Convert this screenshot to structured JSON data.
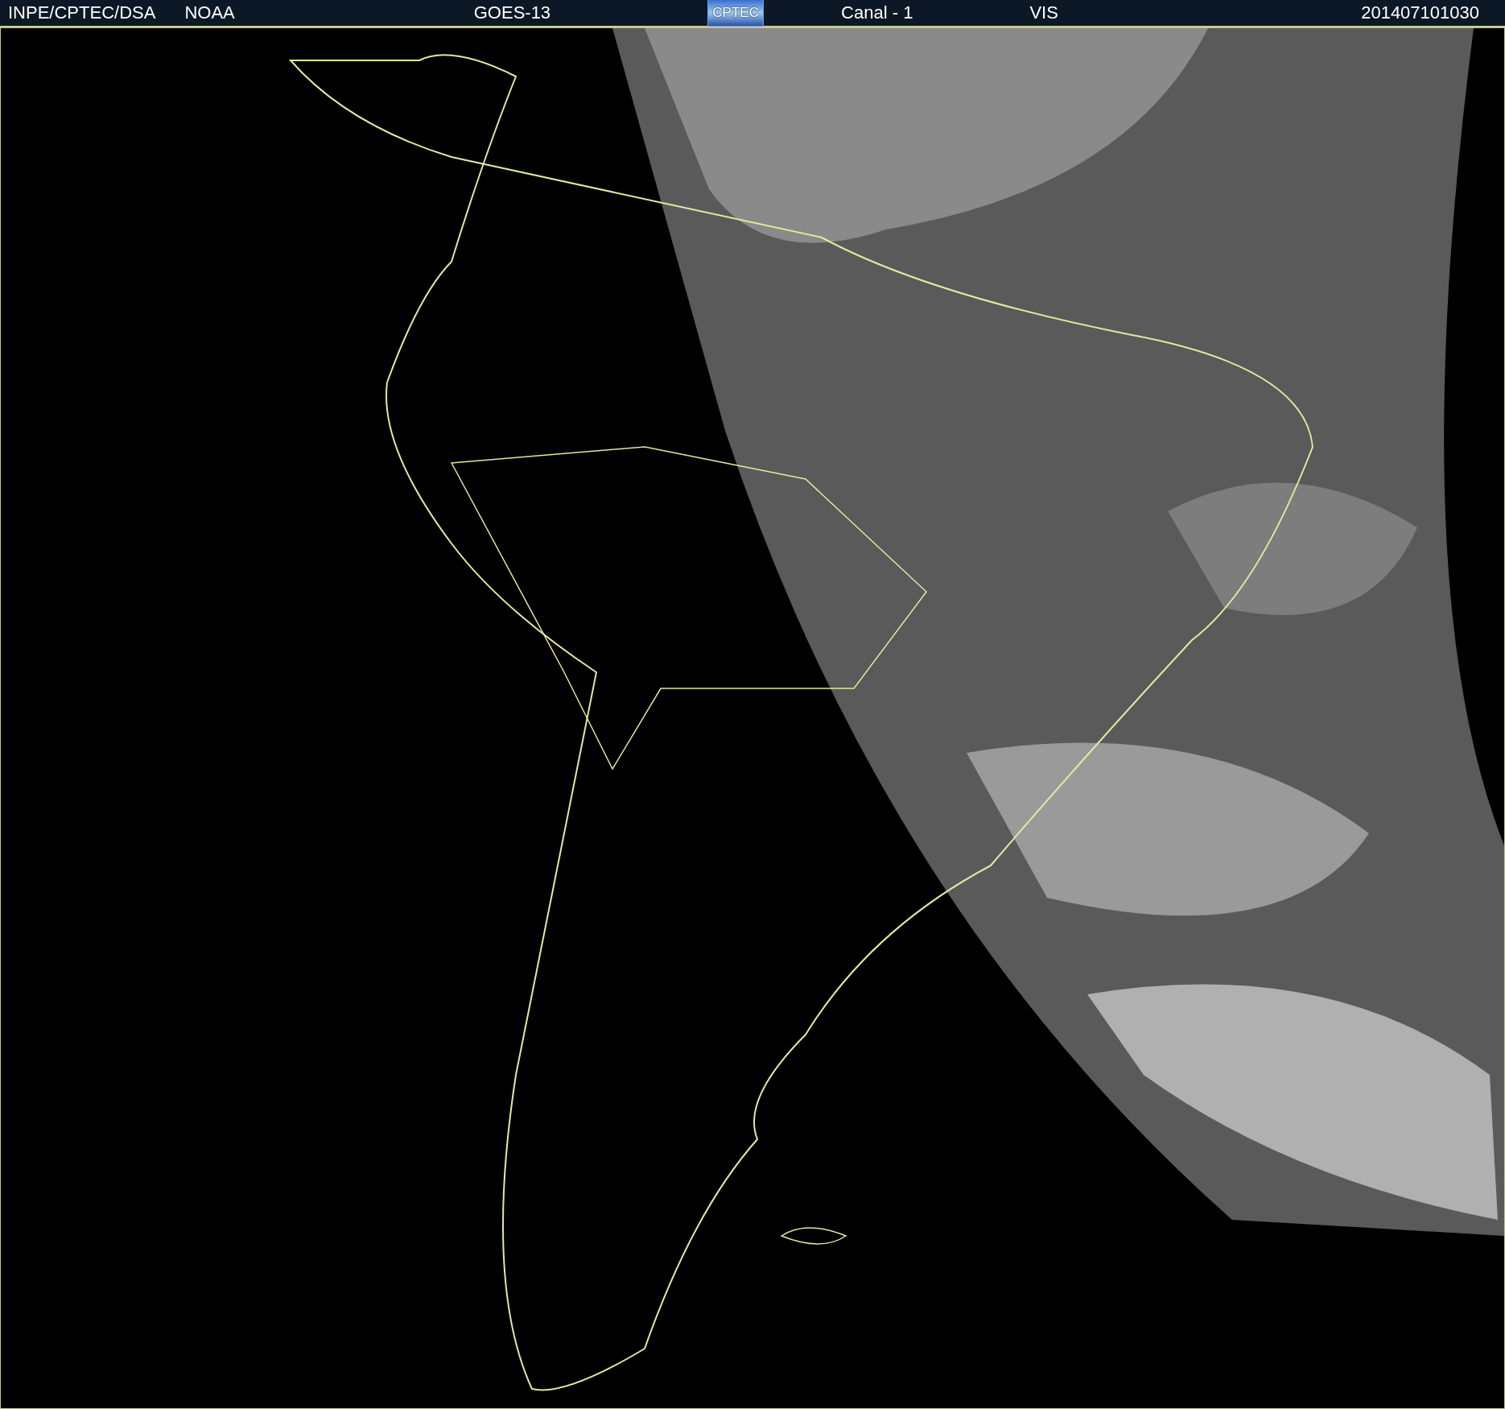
{
  "header": {
    "source": "INPE/CPTEC/DSA",
    "agency": "NOAA",
    "satellite": "GOES-13",
    "logo": "CPTEC",
    "channel": "Canal - 1",
    "band": "VIS",
    "timestamp": "201407101030"
  }
}
